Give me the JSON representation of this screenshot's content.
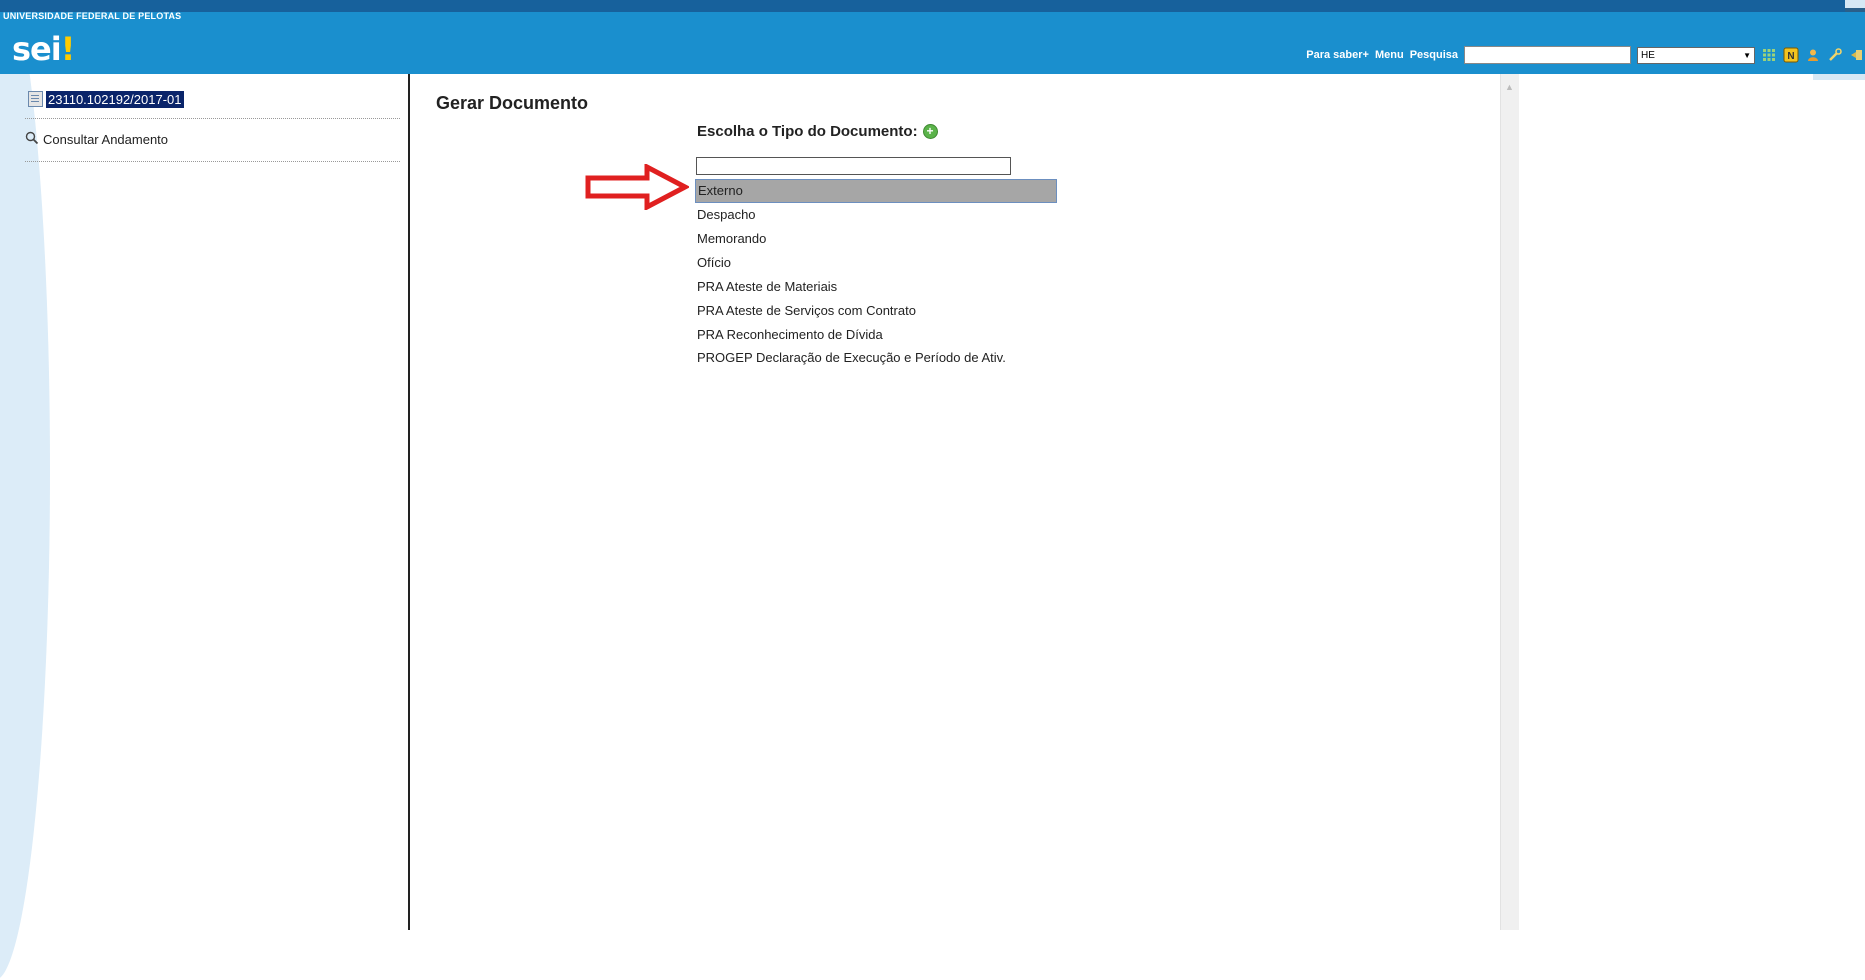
{
  "header": {
    "org_name": "UNIVERSIDADE FEDERAL DE PELOTAS",
    "logo": "sei",
    "logo_mark": "!",
    "nav": [
      "Para saber+",
      "Menu",
      "Pesquisa"
    ],
    "search_value": "",
    "unit_selected": "HE"
  },
  "sidebar": {
    "process_number": "23110.102192/2017-01",
    "consult_label": "Consultar Andamento"
  },
  "main": {
    "title": "Gerar Documento",
    "choose_label": "Escolha o Tipo do Documento:",
    "filter_value": "",
    "document_types": [
      "Externo",
      "Despacho",
      "Memorando",
      "Ofício",
      "PRA Ateste de Materiais",
      "PRA Ateste de Serviços com Contrato",
      "PRA Reconhecimento de Dívida",
      "PROGEP Declaração de Execução e Período de Ativ."
    ],
    "selected_index": 0
  },
  "colors": {
    "header_bg": "#1a8fce",
    "top_strip": "#17619c",
    "arrow": "#e02020",
    "selected_bg": "#a6a6a6",
    "process_highlight": "#0a246a"
  },
  "icons": [
    "document-icon",
    "magnifier-icon",
    "add-icon",
    "grid-icon",
    "notes-icon",
    "user-icon",
    "tools-icon",
    "exit-icon",
    "red-arrow-annotation"
  ]
}
